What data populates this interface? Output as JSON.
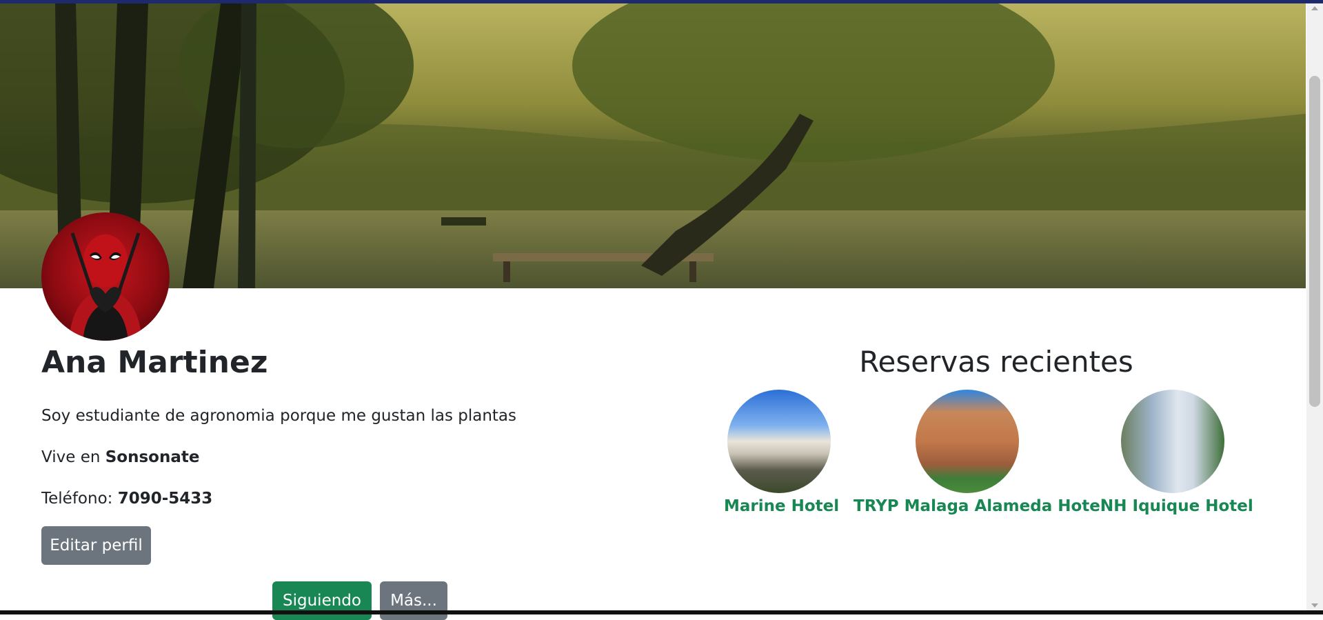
{
  "colors": {
    "primary_text": "#212529",
    "secondary_button": "#6c757d",
    "success_button": "#198754",
    "hotel_link": "#198754"
  },
  "profile": {
    "name": "Ana Martinez",
    "bio": "Soy estudiante de agronomia porque me gustan las plantas",
    "location_prefix": "Vive en",
    "location": "Sonsonate",
    "phone_label": "Teléfono:",
    "phone": "7090-5433",
    "avatar_icon": "deadpool-avatar"
  },
  "actions": {
    "edit_label": "Editar perfil",
    "following_label": "Siguiendo",
    "more_label": "Más..."
  },
  "reservations": {
    "title": "Reservas recientes",
    "hotels": [
      {
        "name": "Marine Hotel"
      },
      {
        "name": "TRYP Malaga Alameda Hotel"
      },
      {
        "name": "NH Iquique Hotel"
      }
    ]
  }
}
